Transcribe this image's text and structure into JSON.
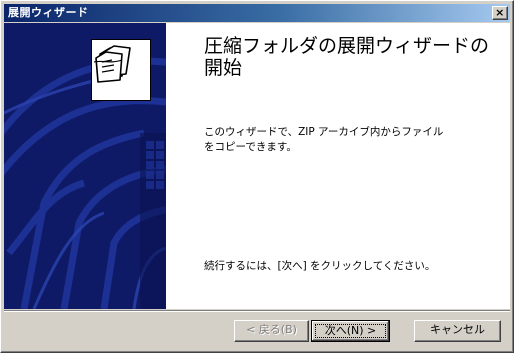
{
  "window": {
    "title": "展開ウィザード",
    "close_glyph": "×"
  },
  "main": {
    "heading": "圧縮フォルダの展開ウィザードの開始",
    "description": "このウィザードで、ZIP アーカイブ内からファイルをコピーできます。",
    "instruction": "続行するには、[次へ] をクリックしてください。"
  },
  "buttons": {
    "back_label": "< 戻る(B)",
    "next_label": "次へ(N) >",
    "cancel_label": "キャンセル",
    "back_enabled": false
  },
  "icons": {
    "wizard": "folder-icon",
    "close": "close-icon"
  },
  "colors": {
    "title_gradient_start": "#0a246a",
    "title_gradient_end": "#a6caf0",
    "side_panel": "#0f1a66",
    "face": "#d4d0c8"
  }
}
